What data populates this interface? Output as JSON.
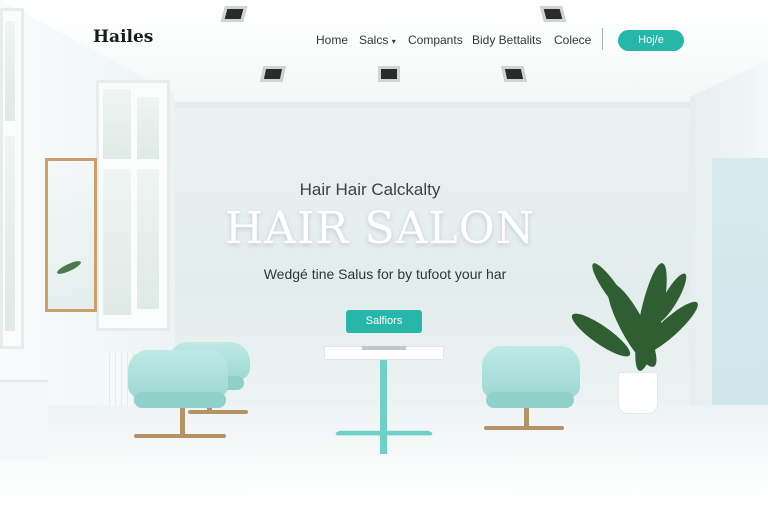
{
  "brand": {
    "logo": "Hailes"
  },
  "nav": {
    "items": [
      {
        "label": "Home"
      },
      {
        "label": "Salcs"
      },
      {
        "label": "Compants"
      },
      {
        "label": "Bidy Bettalits"
      },
      {
        "label": "Colece"
      }
    ],
    "cta_label": "Hoj/e"
  },
  "hero": {
    "kicker": "Hair Hair Calckalty",
    "headline": "HAIR SALON",
    "subtitle": "Wedgé tine Salus for by tufoot your har",
    "button_label": "Salfiors"
  },
  "colors": {
    "accent": "#26b6aa",
    "chair": "#a8ddd8",
    "wood": "#c9a06a"
  },
  "icons": {
    "dropdown": "chevron-down-icon"
  }
}
